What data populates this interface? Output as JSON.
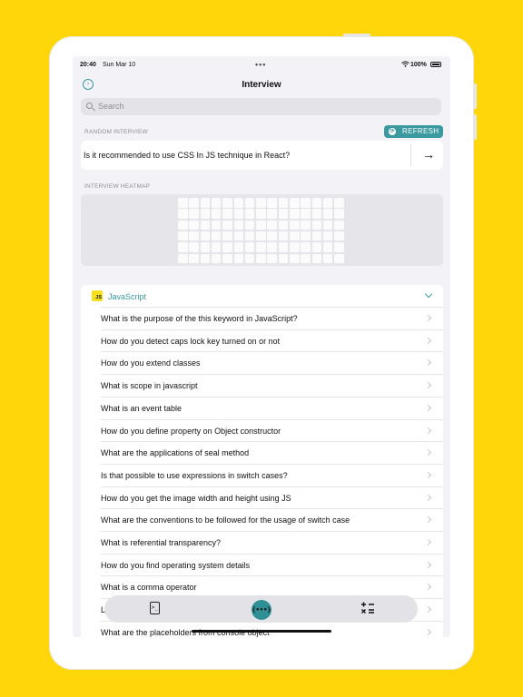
{
  "status_bar": {
    "time": "20:40",
    "date": "Sun Mar 10",
    "battery": "100%"
  },
  "nav": {
    "title": "Interview"
  },
  "search": {
    "placeholder": "Search"
  },
  "random_interview": {
    "label": "RANDOM INTERVIEW",
    "refresh_label": "REFRESH",
    "question": "Is it recommended to use CSS In JS technique in React?"
  },
  "heatmap": {
    "label": "INTERVIEW HEATMAP",
    "columns": 15,
    "rows": 6
  },
  "category": {
    "badge": "JS",
    "title": "JavaScript",
    "questions": [
      "What is the purpose of the this keyword in JavaScript?",
      "How do you detect caps lock key turned on or not",
      "How do you extend classes",
      "What is scope in javascript",
      "What is an event table",
      "How do you define property on Object constructor",
      "What are the applications of seal method",
      "Is that possible to use expressions in switch cases?",
      "How do you get the image width and height using JS",
      "What are the conventions to be followed for the usage of switch case",
      "What is referential transparency?",
      "How do you find operating system details",
      "What is a comma operator",
      "L",
      "What are the placeholders from console object"
    ]
  },
  "tabs": [
    {
      "name": "terminal-icon",
      "glyph": ">_"
    },
    {
      "name": "code-icon",
      "glyph": "{•••}"
    },
    {
      "name": "calculator-icon",
      "glyph": "+−\n×="
    }
  ],
  "colors": {
    "accent": "#3a9aa0",
    "background": "#FFD60A"
  }
}
